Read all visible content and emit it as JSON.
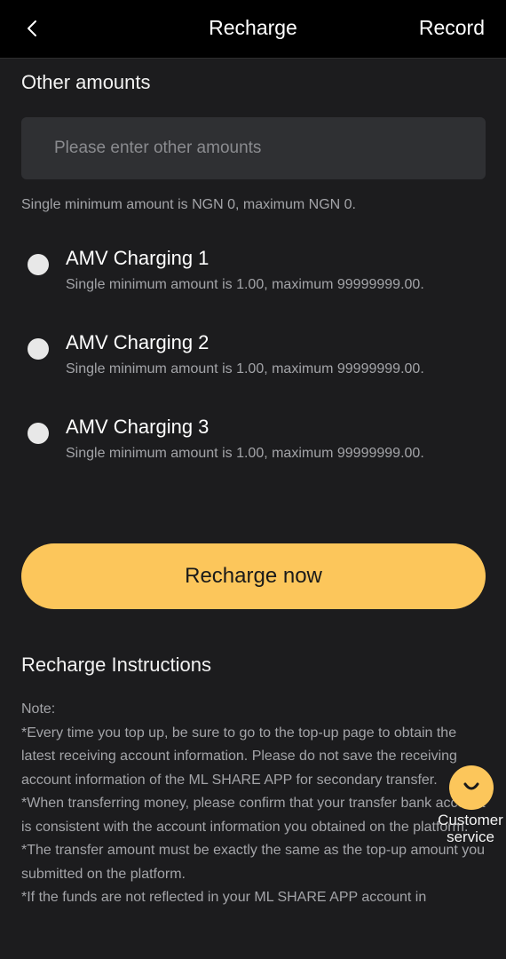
{
  "header": {
    "title": "Recharge",
    "record_label": "Record",
    "back_icon": "chevron-left-icon"
  },
  "other_amounts": {
    "label": "Other amounts",
    "placeholder": "Please enter other amounts",
    "value": "",
    "limit_note": "Single minimum amount is NGN 0, maximum NGN 0."
  },
  "channels": [
    {
      "name": "AMV Charging 1",
      "limit": "Single minimum amount is 1.00, maximum 99999999.00.",
      "selected": false
    },
    {
      "name": "AMV Charging 2",
      "limit": "Single minimum amount is 1.00, maximum 99999999.00.",
      "selected": false
    },
    {
      "name": "AMV Charging 3",
      "limit": "Single minimum amount is 1.00, maximum 99999999.00.",
      "selected": false
    }
  ],
  "recharge_button": {
    "label": "Recharge now"
  },
  "instructions": {
    "title": "Recharge Instructions",
    "lines": [
      "Note:",
      "*Every time you top up, be sure to go to the top-up page to obtain the latest receiving account information. Please do not save the receiving account information of the ML SHARE APP for secondary transfer.",
      "*When transferring money, please confirm that your transfer bank account is consistent with the account information you obtained on the platform.",
      "*The transfer amount must be exactly the same as the top-up amount you submitted on the platform.",
      "*If the funds are not reflected in your ML SHARE APP account in"
    ]
  },
  "customer_service": {
    "label_line1": "Customer",
    "label_line2": "service",
    "icon": "smile-chat-icon"
  },
  "colors": {
    "background": "#1c1c1e",
    "header": "#000000",
    "accent": "#fcc65b",
    "input": "#2f3033",
    "muted_text": "#a3a4a8"
  }
}
